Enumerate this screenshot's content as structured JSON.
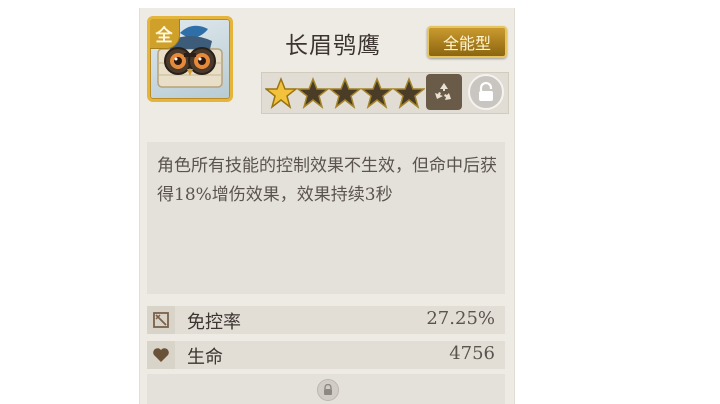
{
  "hero": {
    "name": "长眉鸮鹰",
    "badge": "全",
    "type_label": "全能型",
    "stars_filled": 1,
    "stars_total": 5
  },
  "skill": {
    "description": "角色所有技能的控制效果不生效，但命中后获得18%增伤效果，效果持续3秒"
  },
  "stats": [
    {
      "icon": "control-immunity-icon",
      "label": "免控率",
      "value": "27.25%"
    },
    {
      "icon": "heart-icon",
      "label": "生命",
      "value": "4756"
    }
  ],
  "icons": {
    "recycle": "recycle-icon",
    "lock": "lock-icon"
  },
  "colors": {
    "gold": "#e5b43b",
    "panel": "#eeebe4",
    "text": "#3c3430"
  }
}
